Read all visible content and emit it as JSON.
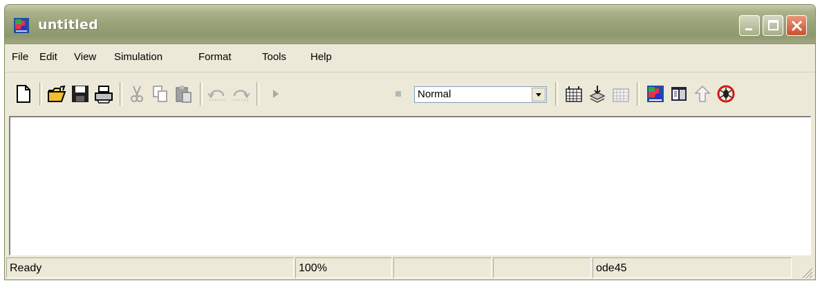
{
  "window": {
    "title": "untitled",
    "accent_color": "#9aa279"
  },
  "menu": {
    "items": [
      "File",
      "Edit",
      "View",
      "Simulation",
      "Format",
      "Tools",
      "Help"
    ]
  },
  "toolbar": {
    "icons": [
      "new-model-icon",
      "open-icon",
      "save-icon",
      "print-icon",
      "cut-icon",
      "copy-icon",
      "paste-icon",
      "undo-icon",
      "redo-icon",
      "start-simulation-icon",
      "stop-simulation-icon",
      "build-icon",
      "update-diagram-icon",
      "build-subsystem-icon",
      "library-browser-icon",
      "model-explorer-icon",
      "go-to-parent-icon",
      "debug-icon"
    ],
    "sim_mode": "Normal"
  },
  "status": {
    "message": "Ready",
    "zoom": "100%",
    "field3": "",
    "field4": "",
    "solver": "ode45"
  }
}
